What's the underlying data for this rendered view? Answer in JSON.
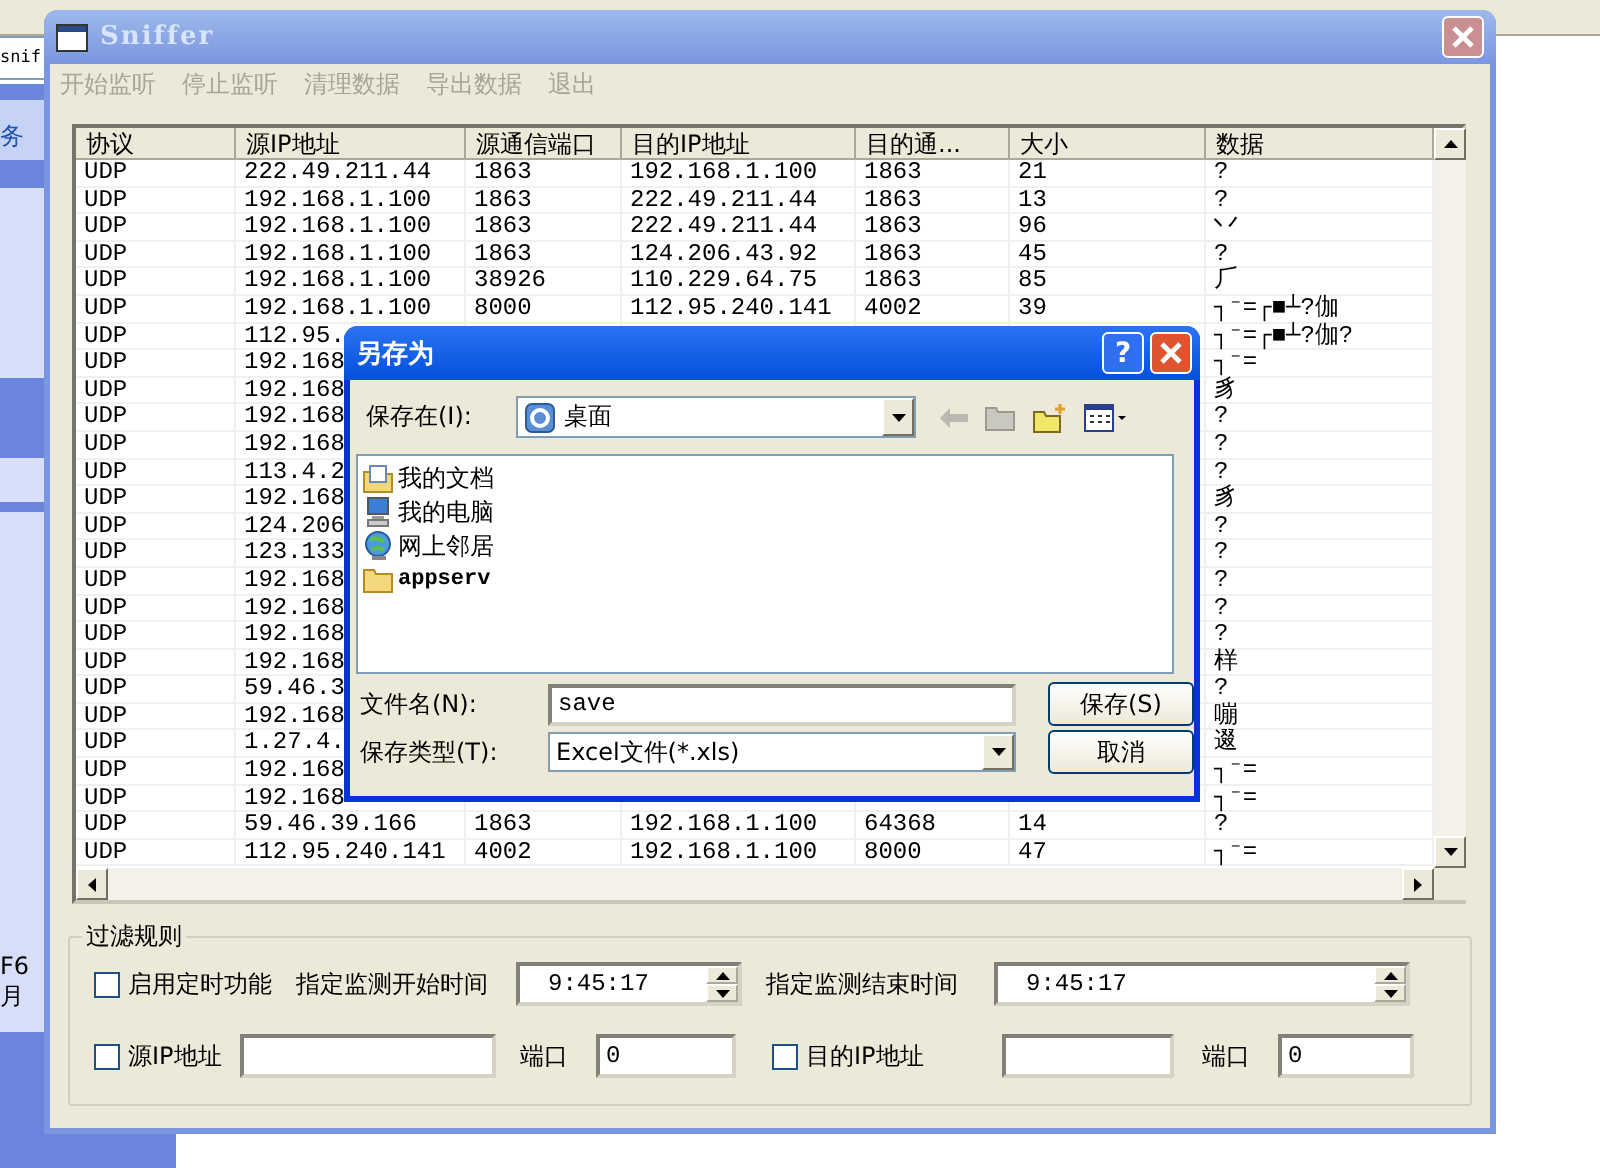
{
  "background": {
    "address_text": "snif",
    "sidebar_texts": [
      "务",
      "F6月"
    ]
  },
  "window": {
    "title": "Sniffer",
    "active": false
  },
  "menu": [
    {
      "label": "开始监听",
      "disabled": true
    },
    {
      "label": "停止监听",
      "disabled": true
    },
    {
      "label": "清理数据",
      "disabled": true
    },
    {
      "label": "导出数据",
      "disabled": true
    },
    {
      "label": "退出",
      "disabled": true
    }
  ],
  "table": {
    "columns": [
      "协议",
      "源IP地址",
      "源通信端口",
      "目的IP地址",
      "目的通...",
      "大小",
      "数据"
    ],
    "rows": [
      {
        "protocol": "UDP",
        "src_ip": "222.49.211.44",
        "src_port": "1863",
        "dst_ip": "192.168.1.100",
        "dst_port": "1863",
        "size": "21",
        "data": "?"
      },
      {
        "protocol": "UDP",
        "src_ip": "192.168.1.100",
        "src_port": "1863",
        "dst_ip": "222.49.211.44",
        "dst_port": "1863",
        "size": "13",
        "data": "?"
      },
      {
        "protocol": "UDP",
        "src_ip": "192.168.1.100",
        "src_port": "1863",
        "dst_ip": "222.49.211.44",
        "dst_port": "1863",
        "size": "96",
        "data": "丷"
      },
      {
        "protocol": "UDP",
        "src_ip": "192.168.1.100",
        "src_port": "1863",
        "dst_ip": "124.206.43.92",
        "dst_port": "1863",
        "size": "45",
        "data": "?"
      },
      {
        "protocol": "UDP",
        "src_ip": "192.168.1.100",
        "src_port": "38926",
        "dst_ip": "110.229.64.75",
        "dst_port": "1863",
        "size": "85",
        "data": "⺁"
      },
      {
        "protocol": "UDP",
        "src_ip": "192.168.1.100",
        "src_port": "8000",
        "dst_ip": "112.95.240.141",
        "dst_port": "4002",
        "size": "39",
        "data": "┐⁻=┌■┴?伽"
      },
      {
        "protocol": "UDP",
        "src_ip": "112.95.",
        "data": "┐⁻=┌■┴?伽?"
      },
      {
        "protocol": "UDP",
        "src_ip": "192.168",
        "data": "┐⁻="
      },
      {
        "protocol": "UDP",
        "src_ip": "192.168",
        "data": "豸"
      },
      {
        "protocol": "UDP",
        "src_ip": "192.168",
        "data": "?"
      },
      {
        "protocol": "UDP",
        "src_ip": "192.168",
        "data": "?"
      },
      {
        "protocol": "UDP",
        "src_ip": "113.4.2",
        "data": "?"
      },
      {
        "protocol": "UDP",
        "src_ip": "192.168",
        "data": "豸"
      },
      {
        "protocol": "UDP",
        "src_ip": "124.206",
        "data": "?"
      },
      {
        "protocol": "UDP",
        "src_ip": "123.133",
        "data": "?"
      },
      {
        "protocol": "UDP",
        "src_ip": "192.168",
        "data": "?"
      },
      {
        "protocol": "UDP",
        "src_ip": "192.168",
        "data": "?"
      },
      {
        "protocol": "UDP",
        "src_ip": "192.168",
        "data": "?"
      },
      {
        "protocol": "UDP",
        "src_ip": "192.168",
        "data": "样"
      },
      {
        "protocol": "UDP",
        "src_ip": "59.46.3",
        "data": "?"
      },
      {
        "protocol": "UDP",
        "src_ip": "192.168",
        "data": "嘣"
      },
      {
        "protocol": "UDP",
        "src_ip": "1.27.4.",
        "data": "逫"
      },
      {
        "protocol": "UDP",
        "src_ip": "192.168",
        "data": "┐⁻="
      },
      {
        "protocol": "UDP",
        "src_ip": "192.168",
        "data": "┐⁻="
      },
      {
        "protocol": "UDP",
        "src_ip": "59.46.39.166",
        "src_port": "1863",
        "dst_ip": "192.168.1.100",
        "dst_port": "64368",
        "size": "14",
        "data": "?"
      },
      {
        "protocol": "UDP",
        "src_ip": "112.95.240.141",
        "src_port": "4002",
        "dst_ip": "192.168.1.100",
        "dst_port": "8000",
        "size": "47",
        "data": "┐⁻="
      }
    ]
  },
  "filter": {
    "title": "过滤规则",
    "timer": {
      "label": "启用定时功能",
      "checked": false
    },
    "start_label": "指定监测开始时间",
    "start_time": "9:45:17",
    "end_label": "指定监测结束时间",
    "end_time": "9:45:17",
    "src_ip": {
      "label": "源IP地址",
      "checked": false
    },
    "src_port": {
      "label": "端口",
      "value": "0"
    },
    "dst_ip": {
      "label": "目的IP地址",
      "checked": false
    },
    "dst_port": {
      "label": "端口",
      "value": "0"
    }
  },
  "dialog": {
    "title": "另存为",
    "help": "?",
    "location_label": "保存在(I):",
    "location": "桌面",
    "files": [
      {
        "name": "我的文档",
        "kind": "documents"
      },
      {
        "name": "我的电脑",
        "kind": "computer"
      },
      {
        "name": "网上邻居",
        "kind": "network"
      },
      {
        "name": "appserv",
        "kind": "folder"
      }
    ],
    "filename_label": "文件名(N):",
    "filename": "save",
    "type_label": "保存类型(T):",
    "type": "Excel文件(*.xls)",
    "save_button": "保存(S)",
    "cancel_button": "取消"
  }
}
